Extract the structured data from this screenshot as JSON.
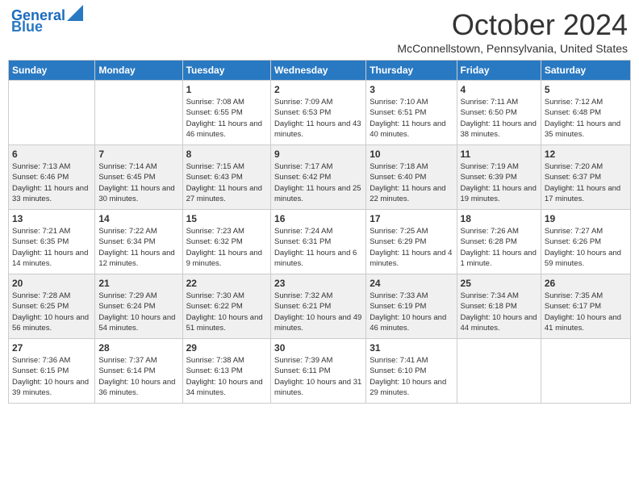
{
  "header": {
    "logo_line1": "General",
    "logo_line2": "Blue",
    "month": "October 2024",
    "location": "McConnellstown, Pennsylvania, United States"
  },
  "days_of_week": [
    "Sunday",
    "Monday",
    "Tuesday",
    "Wednesday",
    "Thursday",
    "Friday",
    "Saturday"
  ],
  "weeks": [
    [
      {
        "day": "",
        "sunrise": "",
        "sunset": "",
        "daylight": ""
      },
      {
        "day": "",
        "sunrise": "",
        "sunset": "",
        "daylight": ""
      },
      {
        "day": "1",
        "sunrise": "Sunrise: 7:08 AM",
        "sunset": "Sunset: 6:55 PM",
        "daylight": "Daylight: 11 hours and 46 minutes."
      },
      {
        "day": "2",
        "sunrise": "Sunrise: 7:09 AM",
        "sunset": "Sunset: 6:53 PM",
        "daylight": "Daylight: 11 hours and 43 minutes."
      },
      {
        "day": "3",
        "sunrise": "Sunrise: 7:10 AM",
        "sunset": "Sunset: 6:51 PM",
        "daylight": "Daylight: 11 hours and 40 minutes."
      },
      {
        "day": "4",
        "sunrise": "Sunrise: 7:11 AM",
        "sunset": "Sunset: 6:50 PM",
        "daylight": "Daylight: 11 hours and 38 minutes."
      },
      {
        "day": "5",
        "sunrise": "Sunrise: 7:12 AM",
        "sunset": "Sunset: 6:48 PM",
        "daylight": "Daylight: 11 hours and 35 minutes."
      }
    ],
    [
      {
        "day": "6",
        "sunrise": "Sunrise: 7:13 AM",
        "sunset": "Sunset: 6:46 PM",
        "daylight": "Daylight: 11 hours and 33 minutes."
      },
      {
        "day": "7",
        "sunrise": "Sunrise: 7:14 AM",
        "sunset": "Sunset: 6:45 PM",
        "daylight": "Daylight: 11 hours and 30 minutes."
      },
      {
        "day": "8",
        "sunrise": "Sunrise: 7:15 AM",
        "sunset": "Sunset: 6:43 PM",
        "daylight": "Daylight: 11 hours and 27 minutes."
      },
      {
        "day": "9",
        "sunrise": "Sunrise: 7:17 AM",
        "sunset": "Sunset: 6:42 PM",
        "daylight": "Daylight: 11 hours and 25 minutes."
      },
      {
        "day": "10",
        "sunrise": "Sunrise: 7:18 AM",
        "sunset": "Sunset: 6:40 PM",
        "daylight": "Daylight: 11 hours and 22 minutes."
      },
      {
        "day": "11",
        "sunrise": "Sunrise: 7:19 AM",
        "sunset": "Sunset: 6:39 PM",
        "daylight": "Daylight: 11 hours and 19 minutes."
      },
      {
        "day": "12",
        "sunrise": "Sunrise: 7:20 AM",
        "sunset": "Sunset: 6:37 PM",
        "daylight": "Daylight: 11 hours and 17 minutes."
      }
    ],
    [
      {
        "day": "13",
        "sunrise": "Sunrise: 7:21 AM",
        "sunset": "Sunset: 6:35 PM",
        "daylight": "Daylight: 11 hours and 14 minutes."
      },
      {
        "day": "14",
        "sunrise": "Sunrise: 7:22 AM",
        "sunset": "Sunset: 6:34 PM",
        "daylight": "Daylight: 11 hours and 12 minutes."
      },
      {
        "day": "15",
        "sunrise": "Sunrise: 7:23 AM",
        "sunset": "Sunset: 6:32 PM",
        "daylight": "Daylight: 11 hours and 9 minutes."
      },
      {
        "day": "16",
        "sunrise": "Sunrise: 7:24 AM",
        "sunset": "Sunset: 6:31 PM",
        "daylight": "Daylight: 11 hours and 6 minutes."
      },
      {
        "day": "17",
        "sunrise": "Sunrise: 7:25 AM",
        "sunset": "Sunset: 6:29 PM",
        "daylight": "Daylight: 11 hours and 4 minutes."
      },
      {
        "day": "18",
        "sunrise": "Sunrise: 7:26 AM",
        "sunset": "Sunset: 6:28 PM",
        "daylight": "Daylight: 11 hours and 1 minute."
      },
      {
        "day": "19",
        "sunrise": "Sunrise: 7:27 AM",
        "sunset": "Sunset: 6:26 PM",
        "daylight": "Daylight: 10 hours and 59 minutes."
      }
    ],
    [
      {
        "day": "20",
        "sunrise": "Sunrise: 7:28 AM",
        "sunset": "Sunset: 6:25 PM",
        "daylight": "Daylight: 10 hours and 56 minutes."
      },
      {
        "day": "21",
        "sunrise": "Sunrise: 7:29 AM",
        "sunset": "Sunset: 6:24 PM",
        "daylight": "Daylight: 10 hours and 54 minutes."
      },
      {
        "day": "22",
        "sunrise": "Sunrise: 7:30 AM",
        "sunset": "Sunset: 6:22 PM",
        "daylight": "Daylight: 10 hours and 51 minutes."
      },
      {
        "day": "23",
        "sunrise": "Sunrise: 7:32 AM",
        "sunset": "Sunset: 6:21 PM",
        "daylight": "Daylight: 10 hours and 49 minutes."
      },
      {
        "day": "24",
        "sunrise": "Sunrise: 7:33 AM",
        "sunset": "Sunset: 6:19 PM",
        "daylight": "Daylight: 10 hours and 46 minutes."
      },
      {
        "day": "25",
        "sunrise": "Sunrise: 7:34 AM",
        "sunset": "Sunset: 6:18 PM",
        "daylight": "Daylight: 10 hours and 44 minutes."
      },
      {
        "day": "26",
        "sunrise": "Sunrise: 7:35 AM",
        "sunset": "Sunset: 6:17 PM",
        "daylight": "Daylight: 10 hours and 41 minutes."
      }
    ],
    [
      {
        "day": "27",
        "sunrise": "Sunrise: 7:36 AM",
        "sunset": "Sunset: 6:15 PM",
        "daylight": "Daylight: 10 hours and 39 minutes."
      },
      {
        "day": "28",
        "sunrise": "Sunrise: 7:37 AM",
        "sunset": "Sunset: 6:14 PM",
        "daylight": "Daylight: 10 hours and 36 minutes."
      },
      {
        "day": "29",
        "sunrise": "Sunrise: 7:38 AM",
        "sunset": "Sunset: 6:13 PM",
        "daylight": "Daylight: 10 hours and 34 minutes."
      },
      {
        "day": "30",
        "sunrise": "Sunrise: 7:39 AM",
        "sunset": "Sunset: 6:11 PM",
        "daylight": "Daylight: 10 hours and 31 minutes."
      },
      {
        "day": "31",
        "sunrise": "Sunrise: 7:41 AM",
        "sunset": "Sunset: 6:10 PM",
        "daylight": "Daylight: 10 hours and 29 minutes."
      },
      {
        "day": "",
        "sunrise": "",
        "sunset": "",
        "daylight": ""
      },
      {
        "day": "",
        "sunrise": "",
        "sunset": "",
        "daylight": ""
      }
    ]
  ]
}
